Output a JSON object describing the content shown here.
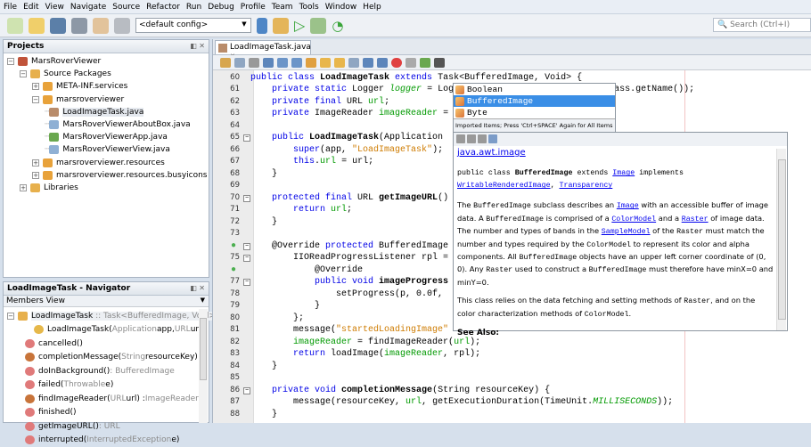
{
  "menu": [
    "File",
    "Edit",
    "View",
    "Navigate",
    "Source",
    "Refactor",
    "Run",
    "Debug",
    "Profile",
    "Team",
    "Tools",
    "Window",
    "Help"
  ],
  "toolbar": {
    "config": "<default config>",
    "search_placeholder": "Search (Ctrl+I)"
  },
  "projects": {
    "title": "Projects",
    "items": [
      {
        "label": "MarsRoverViewer",
        "level": 0,
        "exp": "−",
        "icon": "#c0533a"
      },
      {
        "label": "Source Packages",
        "level": 1,
        "exp": "−",
        "icon": "#e7b04c"
      },
      {
        "label": "META-INF.services",
        "level": 2,
        "exp": "+",
        "icon": "#e8a23a"
      },
      {
        "label": "marsroverviewer",
        "level": 2,
        "exp": "−",
        "icon": "#e8a23a"
      },
      {
        "label": "LoadImageTask.java",
        "level": 3,
        "exp": "",
        "icon": "#b98c6a",
        "selected": true
      },
      {
        "label": "MarsRoverViewerAboutBox.java",
        "level": 3,
        "exp": "",
        "icon": "#8fb0d4"
      },
      {
        "label": "MarsRoverViewerApp.java",
        "level": 3,
        "exp": "",
        "icon": "#6aa84f"
      },
      {
        "label": "MarsRoverViewerView.java",
        "level": 3,
        "exp": "",
        "icon": "#8fb0d4"
      },
      {
        "label": "marsroverviewer.resources",
        "level": 2,
        "exp": "+",
        "icon": "#e8a23a"
      },
      {
        "label": "marsroverviewer.resources.busyicons",
        "level": 2,
        "exp": "+",
        "icon": "#e8a23a"
      },
      {
        "label": "Libraries",
        "level": 1,
        "exp": "+",
        "icon": "#e7b04c"
      }
    ]
  },
  "navigator": {
    "title": "LoadImageTask - Navigator",
    "view": "Members View",
    "root": {
      "name": "LoadImageTask",
      "type": " :: Task<BufferedImage, Void>"
    },
    "members": [
      {
        "name": "LoadImageTask(",
        "params": "Application",
        "rest": " app, ",
        "p2": "URL",
        " tail": "",
        "suffix": " url)",
        "icon": "#e6b84a"
      },
      {
        "name": "cancelled()",
        "params": "",
        "suffix": "",
        "icon": "#e07a7a"
      },
      {
        "name": "completionMessage(",
        "params": "String",
        "suffix": " resourceKey)",
        "icon": "#c8743a"
      },
      {
        "name": "doInBackground()",
        "params": " : BufferedImage",
        "suffix": "",
        "icon": "#e07a7a"
      },
      {
        "name": "failed(",
        "params": "Throwable",
        "suffix": " e)",
        "icon": "#e07a7a"
      },
      {
        "name": "findImageReader(",
        "params": "URL",
        "suffix": " url) : ",
        "ret": "ImageReader",
        "icon": "#c8743a"
      },
      {
        "name": "finished()",
        "params": "",
        "suffix": "",
        "icon": "#e07a7a"
      },
      {
        "name": "getImageURL()",
        "params": " : URL",
        "suffix": "",
        "icon": "#e07a7a"
      },
      {
        "name": "interrupted(",
        "params": "InterruptedException",
        "suffix": " e)",
        "icon": "#e07a7a"
      }
    ]
  },
  "editor": {
    "tab": "LoadImageTask.java",
    "lines": [
      {
        "n": "60",
        "s": [
          [
            "    ",
            ""
          ],
          [
            "public class ",
            "kw"
          ],
          [
            "LoadImageTask ",
            "b"
          ],
          [
            "extends ",
            "kw"
          ],
          [
            "Task<BufferedImage, Void> {",
            ""
          ]
        ]
      },
      {
        "n": "61",
        "s": [
          [
            "        ",
            ""
          ],
          [
            "private static ",
            "kw"
          ],
          [
            "Logger ",
            ""
          ],
          [
            "logger",
            "it"
          ],
          [
            " = Logger.getLogger(LoadImageTask.class.getName());",
            ""
          ]
        ]
      },
      {
        "n": "62",
        "s": [
          [
            "        ",
            ""
          ],
          [
            "private final ",
            "kw"
          ],
          [
            "URL ",
            ""
          ],
          [
            "url",
            "fld"
          ],
          [
            ";",
            ""
          ]
        ]
      },
      {
        "n": "63",
        "s": [
          [
            "        ",
            ""
          ],
          [
            "private ",
            "kw"
          ],
          [
            "ImageReader ",
            ""
          ],
          [
            "imageReader",
            "fld"
          ],
          [
            " = ",
            ""
          ]
        ]
      },
      {
        "n": "64",
        "s": []
      },
      {
        "n": "65",
        "fold": true,
        "s": [
          [
            "        ",
            ""
          ],
          [
            "public ",
            "kw"
          ],
          [
            "LoadImageTask",
            "b"
          ],
          [
            "(Application ",
            ""
          ]
        ]
      },
      {
        "n": "66",
        "s": [
          [
            "            ",
            ""
          ],
          [
            "super",
            "kw"
          ],
          [
            "(app, ",
            ""
          ],
          [
            "\"LoadImageTask\"",
            "str"
          ],
          [
            ");",
            ""
          ]
        ]
      },
      {
        "n": "67",
        "s": [
          [
            "            ",
            ""
          ],
          [
            "this",
            "kw"
          ],
          [
            ".",
            ""
          ],
          [
            "url",
            "fld"
          ],
          [
            " = url;",
            ""
          ]
        ]
      },
      {
        "n": "68",
        "s": [
          [
            "        }",
            ""
          ]
        ]
      },
      {
        "n": "69",
        "s": []
      },
      {
        "n": "70",
        "fold": true,
        "s": [
          [
            "        ",
            ""
          ],
          [
            "protected final ",
            "kw"
          ],
          [
            "URL ",
            ""
          ],
          [
            "getImageURL",
            "b"
          ],
          [
            "()",
            ""
          ]
        ]
      },
      {
        "n": "71",
        "s": [
          [
            "            ",
            ""
          ],
          [
            "return ",
            "kw"
          ],
          [
            "url",
            "fld"
          ],
          [
            ";",
            ""
          ]
        ]
      },
      {
        "n": "72",
        "s": [
          [
            "        }",
            ""
          ]
        ]
      },
      {
        "n": "73",
        "s": []
      },
      {
        "n": "",
        "badge": true,
        "fold": true,
        "s": [
          [
            "        @Override ",
            ""
          ],
          [
            "protected ",
            "kw"
          ],
          [
            "BufferedImage",
            ""
          ]
        ]
      },
      {
        "n": "75",
        "fold": true,
        "s": [
          [
            "            IIOReadProgressListener rpl = ",
            ""
          ]
        ]
      },
      {
        "n": "",
        "badge": true,
        "s": [
          [
            "                @Override",
            ""
          ]
        ]
      },
      {
        "n": "77",
        "fold": true,
        "s": [
          [
            "                ",
            ""
          ],
          [
            "public void ",
            "kw"
          ],
          [
            "imageProgress",
            "b"
          ]
        ]
      },
      {
        "n": "78",
        "s": [
          [
            "                    setProgress(p, 0.0f,",
            ""
          ]
        ]
      },
      {
        "n": "79",
        "s": [
          [
            "                }",
            ""
          ]
        ]
      },
      {
        "n": "80",
        "s": [
          [
            "            };",
            ""
          ]
        ]
      },
      {
        "n": "81",
        "s": [
          [
            "            message(",
            ""
          ],
          [
            "\"startedLoadingImage\"",
            "str"
          ]
        ]
      },
      {
        "n": "82",
        "s": [
          [
            "            ",
            ""
          ],
          [
            "imageReader",
            "fld"
          ],
          [
            " = findImageReader(",
            ""
          ],
          [
            "url",
            "fld"
          ],
          [
            ");",
            ""
          ]
        ]
      },
      {
        "n": "83",
        "s": [
          [
            "            ",
            ""
          ],
          [
            "return ",
            "kw"
          ],
          [
            "loadImage(",
            ""
          ],
          [
            "imageReader",
            "fld"
          ],
          [
            ", rpl);",
            ""
          ]
        ]
      },
      {
        "n": "84",
        "s": [
          [
            "        }",
            ""
          ]
        ]
      },
      {
        "n": "85",
        "s": []
      },
      {
        "n": "86",
        "fold": true,
        "s": [
          [
            "        ",
            ""
          ],
          [
            "private void ",
            "kw"
          ],
          [
            "completionMessage",
            "b"
          ],
          [
            "(String resourceKey) {",
            ""
          ]
        ]
      },
      {
        "n": "87",
        "s": [
          [
            "            message(resourceKey, ",
            ""
          ],
          [
            "url",
            "fld"
          ],
          [
            ", getExecutionDuration(TimeUnit.",
            ""
          ],
          [
            "MILLISECONDS",
            "it"
          ],
          [
            "));",
            ""
          ]
        ]
      },
      {
        "n": "88",
        "s": [
          [
            "        }",
            ""
          ]
        ]
      }
    ]
  },
  "completion": {
    "items": [
      "Boolean",
      "BufferedImage",
      "Byte"
    ],
    "selected": 1,
    "hint": "Imported Items; Press 'Ctrl+SPACE' Again for All Items"
  },
  "doc": {
    "package": "java.awt.image",
    "sig1": "public class ",
    "sig_name": "BufferedImage",
    "sig2": " extends ",
    "sig_link1": "Image",
    "sig3": " implements ",
    "sig_link2": "WritableRenderedImage",
    "sig4": ", ",
    "sig_link3": "Transparency",
    "p1": [
      [
        "The ",
        ""
      ],
      [
        "BufferedImage",
        "m"
      ],
      [
        " subclass describes an ",
        ""
      ],
      [
        "Image",
        "a"
      ],
      [
        " with an accessible buffer of image data. A ",
        ""
      ],
      [
        "BufferedImage",
        "m"
      ],
      [
        " is comprised of a ",
        ""
      ],
      [
        "ColorModel",
        "a"
      ],
      [
        " and a ",
        ""
      ],
      [
        "Raster",
        "a"
      ],
      [
        " of image data. The number and types of bands in the ",
        ""
      ],
      [
        "SampleModel",
        "a"
      ],
      [
        " of the ",
        ""
      ],
      [
        "Raster",
        "m"
      ],
      [
        " must match the number and types required by the ",
        ""
      ],
      [
        "ColorModel",
        "m"
      ],
      [
        " to represent its color and alpha components. All ",
        ""
      ],
      [
        "BufferedImage",
        "m"
      ],
      [
        " objects have an upper left corner coordinate of (0, 0). Any ",
        ""
      ],
      [
        "Raster",
        "m"
      ],
      [
        " used to construct a ",
        ""
      ],
      [
        "BufferedImage",
        "m"
      ],
      [
        " must therefore have minX=0 and minY=0.",
        ""
      ]
    ],
    "p2": [
      [
        "This class relies on the data fetching and setting methods of ",
        ""
      ],
      [
        "Raster",
        "m"
      ],
      [
        ", and on the color characterization methods of ",
        ""
      ],
      [
        "ColorModel",
        "m"
      ],
      [
        ".",
        ""
      ]
    ],
    "see_also": "See Also:"
  }
}
